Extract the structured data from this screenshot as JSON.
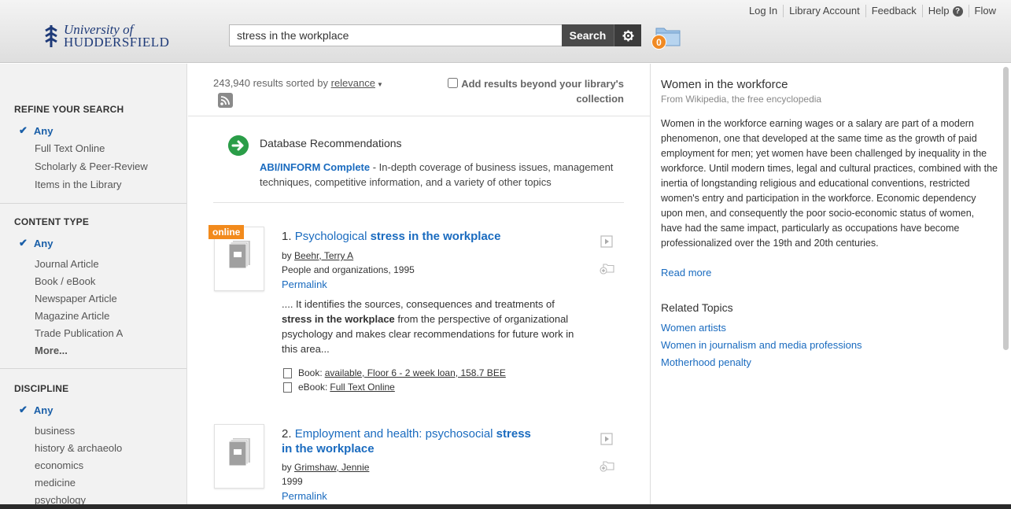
{
  "header": {
    "logo_line1": "University of",
    "logo_line2": "HUDDERSFIELD",
    "nav": [
      "Log In",
      "Library Account",
      "Feedback",
      "Help",
      "Flow"
    ],
    "search_value": "stress in the workplace",
    "search_button": "Search",
    "folder_count": "0"
  },
  "sidebar": {
    "refine": {
      "title": "REFINE YOUR SEARCH",
      "any": "Any",
      "items": [
        "Full Text Online",
        "Scholarly & Peer-Review",
        "Items in the Library"
      ]
    },
    "content_type": {
      "title": "CONTENT TYPE",
      "any": "Any",
      "items": [
        "Journal Article",
        "Book / eBook",
        "Newspaper Article",
        "Magazine Article",
        "Trade Publication A"
      ],
      "more": "More..."
    },
    "discipline": {
      "title": "DISCIPLINE",
      "any": "Any",
      "items": [
        "business",
        "history & archaeolo",
        "economics",
        "medicine",
        "psychology"
      ]
    }
  },
  "results": {
    "count_text": "243,940 results sorted by",
    "sort_label": "relevance",
    "beyond_label": "Add results beyond your library's collection",
    "db_rec": {
      "title": "Database Recommendations",
      "link": "ABI/INFORM Complete",
      "desc": " - In-depth coverage of business issues, management techniques, competitive information, and a variety of other topics"
    },
    "items": [
      {
        "num": "1.",
        "title_plain": "Psychological",
        "title_bold": "stress in the workplace",
        "tag": "online",
        "by": "by",
        "author": "Beehr, Terry A",
        "pub": "People and organizations, 1995",
        "permalink": "Permalink",
        "snippet_pre": ".... It identifies the sources, consequences and treatments of",
        "snippet_bold": "stress in the workplace",
        "snippet_post": "from the perspective of organizational psychology and makes clear recommendations for future work in this area...",
        "avail": [
          {
            "label": "Book:",
            "link": "available, Floor 6 - 2 week loan, 158.7 BEE"
          },
          {
            "label": "eBook:",
            "link": "Full Text Online"
          }
        ]
      },
      {
        "num": "2.",
        "title_plain": "Employment and health: psychosocial",
        "title_bold": "stress in the workplace",
        "by": "by",
        "author": "Grimshaw, Jennie",
        "pub": "1999",
        "permalink": "Permalink"
      }
    ]
  },
  "rightpanel": {
    "title": "Women in the workforce",
    "source": "From Wikipedia, the free encyclopedia",
    "body": "Women in the workforce earning wages or a salary are part of a modern phenomenon, one that developed at the same time as the growth of paid employment for men; yet women have been challenged by inequality in the workforce. Until modern times, legal and cultural practices, combined with the inertia of longstanding religious and educational conventions, restricted women's entry and participation in the workforce. Economic dependency upon men, and consequently the poor socio-economic status of women, have had the same impact, particularly as occupations have become professionalized over the 19th and 20th centuries.",
    "read_more": "Read more",
    "related_title": "Related Topics",
    "related": [
      "Women artists",
      "Women in journalism and media professions",
      "Motherhood penalty"
    ]
  },
  "colors": {
    "link": "#1a6bbf",
    "online_tag": "#f28a1c",
    "search_button": "#4a4a4a",
    "db_arrow": "#2a9d48",
    "folder_badge": "#f08a24"
  },
  "icons": [
    "logo-crest-icon",
    "help-icon",
    "gear-icon",
    "folder-icon",
    "rss-icon",
    "arrow-right-icon",
    "book-icon",
    "preview-icon",
    "add-to-folder-icon",
    "checkmark-icon"
  ]
}
